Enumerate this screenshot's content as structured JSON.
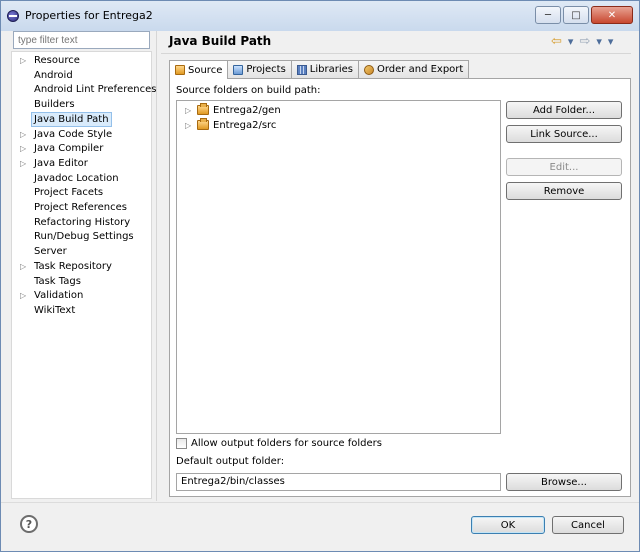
{
  "window": {
    "title": "Properties for Entrega2"
  },
  "filter": {
    "placeholder": "type filter text"
  },
  "nav": {
    "items": [
      {
        "label": "Resource",
        "expandable": true
      },
      {
        "label": "Android",
        "expandable": false
      },
      {
        "label": "Android Lint Preferences",
        "expandable": false
      },
      {
        "label": "Builders",
        "expandable": false
      },
      {
        "label": "Java Build Path",
        "expandable": false,
        "selected": true
      },
      {
        "label": "Java Code Style",
        "expandable": true
      },
      {
        "label": "Java Compiler",
        "expandable": true
      },
      {
        "label": "Java Editor",
        "expandable": true
      },
      {
        "label": "Javadoc Location",
        "expandable": false
      },
      {
        "label": "Project Facets",
        "expandable": false
      },
      {
        "label": "Project References",
        "expandable": false
      },
      {
        "label": "Refactoring History",
        "expandable": false
      },
      {
        "label": "Run/Debug Settings",
        "expandable": false
      },
      {
        "label": "Server",
        "expandable": false
      },
      {
        "label": "Task Repository",
        "expandable": true
      },
      {
        "label": "Task Tags",
        "expandable": false
      },
      {
        "label": "Validation",
        "expandable": true
      },
      {
        "label": "WikiText",
        "expandable": false
      }
    ]
  },
  "page": {
    "title": "Java Build Path"
  },
  "tabs": [
    {
      "label": "Source",
      "icon": "source-folder-icon",
      "active": true
    },
    {
      "label": "Projects",
      "icon": "projects-icon"
    },
    {
      "label": "Libraries",
      "icon": "libraries-icon"
    },
    {
      "label": "Order and Export",
      "icon": "order-export-icon"
    }
  ],
  "source": {
    "label": "Source folders on build path:",
    "folders": [
      "Entrega2/gen",
      "Entrega2/src"
    ],
    "buttons": {
      "add_folder": "Add Folder...",
      "link_source": "Link Source...",
      "edit": "Edit...",
      "remove": "Remove"
    },
    "allow_output_label": "Allow output folders for source folders",
    "allow_output_checked": false,
    "default_output_label": "Default output folder:",
    "default_output_value": "Entrega2/bin/classes",
    "browse": "Browse..."
  },
  "footer": {
    "ok": "OK",
    "cancel": "Cancel"
  }
}
